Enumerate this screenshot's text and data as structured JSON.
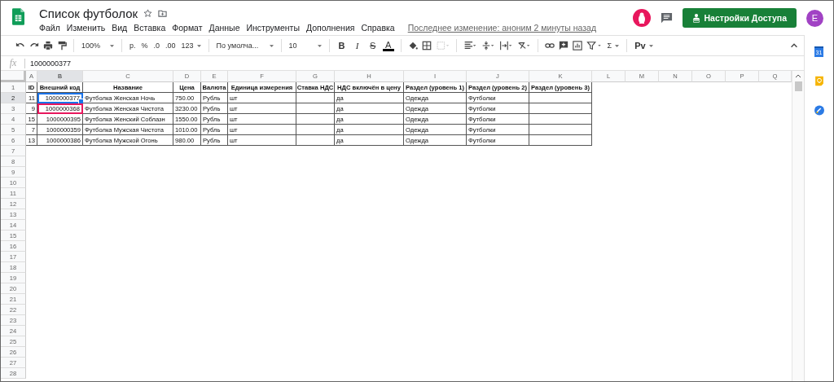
{
  "document": {
    "title": "Список футболок",
    "last_edit": "Последнее изменение: аноним 2 минуты назад"
  },
  "menu": [
    "Файл",
    "Изменить",
    "Вид",
    "Вставка",
    "Формат",
    "Данные",
    "Инструменты",
    "Дополнения",
    "Справка"
  ],
  "share_button": "Настройки Доступа",
  "account_initial": "E",
  "toolbar": {
    "zoom": "100%",
    "currency": "р.",
    "percent": "%",
    "decrease_decimals": ".0",
    "increase_decimals": ".00",
    "more_formats": "123",
    "font": "По умолча...",
    "font_size": "10",
    "bold": "B",
    "italic": "I",
    "strikethrough": "S",
    "text_color": "A",
    "functions": "Σ",
    "addon": "Pv"
  },
  "formula_bar": {
    "label": "fx",
    "value": "1000000377"
  },
  "sheet": {
    "columns": [
      "A",
      "B",
      "C",
      "D",
      "E",
      "F",
      "G",
      "H",
      "I",
      "J",
      "K",
      "L",
      "M",
      "N",
      "O",
      "P",
      "Q"
    ],
    "rows": [
      {
        "number": "1",
        "kind": "header",
        "active": false,
        "collaborator_cursor": false,
        "cells": {
          "A": "ID",
          "B": "Внешний код",
          "C": "Название",
          "D": "Цена",
          "E": "Валюта",
          "F": "Единица измерения",
          "G": "Ставка НДС",
          "H": "НДС включён в цену",
          "I": "Раздел (уровень 1)",
          "J": "Раздел (уровень 2)",
          "K": "Раздел (уровень 3)"
        }
      },
      {
        "number": "2",
        "kind": "data",
        "active": true,
        "collaborator_cursor": false,
        "cells": {
          "A": "11",
          "B": "1000000377",
          "C": "Футболка Женская Ночь",
          "D": "750.00",
          "E": "Рубль",
          "F": "шт",
          "H": "да",
          "I": "Одежда",
          "J": "Футболки"
        }
      },
      {
        "number": "3",
        "kind": "data",
        "active": false,
        "collaborator_cursor": true,
        "cells": {
          "A": "9",
          "B": "1000000368",
          "C": "Футболка Женская Чистота",
          "D": "3230.00",
          "E": "Рубль",
          "F": "шт",
          "H": "да",
          "I": "Одежда",
          "J": "Футболки"
        }
      },
      {
        "number": "4",
        "kind": "data",
        "active": false,
        "collaborator_cursor": false,
        "cells": {
          "A": "15",
          "B": "1000000395",
          "C": "Футболка Женский Соблазн",
          "D": "1550.00",
          "E": "Рубль",
          "F": "шт",
          "H": "да",
          "I": "Одежда",
          "J": "Футболки"
        }
      },
      {
        "number": "5",
        "kind": "data",
        "active": false,
        "collaborator_cursor": false,
        "cells": {
          "A": "7",
          "B": "1000000359",
          "C": "Футболка Мужская Чистота",
          "D": "1010.00",
          "E": "Рубль",
          "F": "шт",
          "H": "да",
          "I": "Одежда",
          "J": "Футболки"
        }
      },
      {
        "number": "6",
        "kind": "data",
        "active": false,
        "collaborator_cursor": false,
        "cells": {
          "A": "13",
          "B": "1000000386",
          "C": "Футболка Мужской Огонь",
          "D": "980.00",
          "E": "Рубль",
          "F": "шт",
          "H": "да",
          "I": "Одежда",
          "J": "Футболки"
        }
      }
    ],
    "empty_rows": [
      "7",
      "8",
      "9",
      "10",
      "11",
      "12",
      "13",
      "14",
      "15",
      "16",
      "17",
      "18",
      "19",
      "20",
      "21",
      "22",
      "23",
      "24",
      "25",
      "26",
      "27",
      "28"
    ]
  },
  "side_panel": {
    "calendar_day": "31"
  }
}
